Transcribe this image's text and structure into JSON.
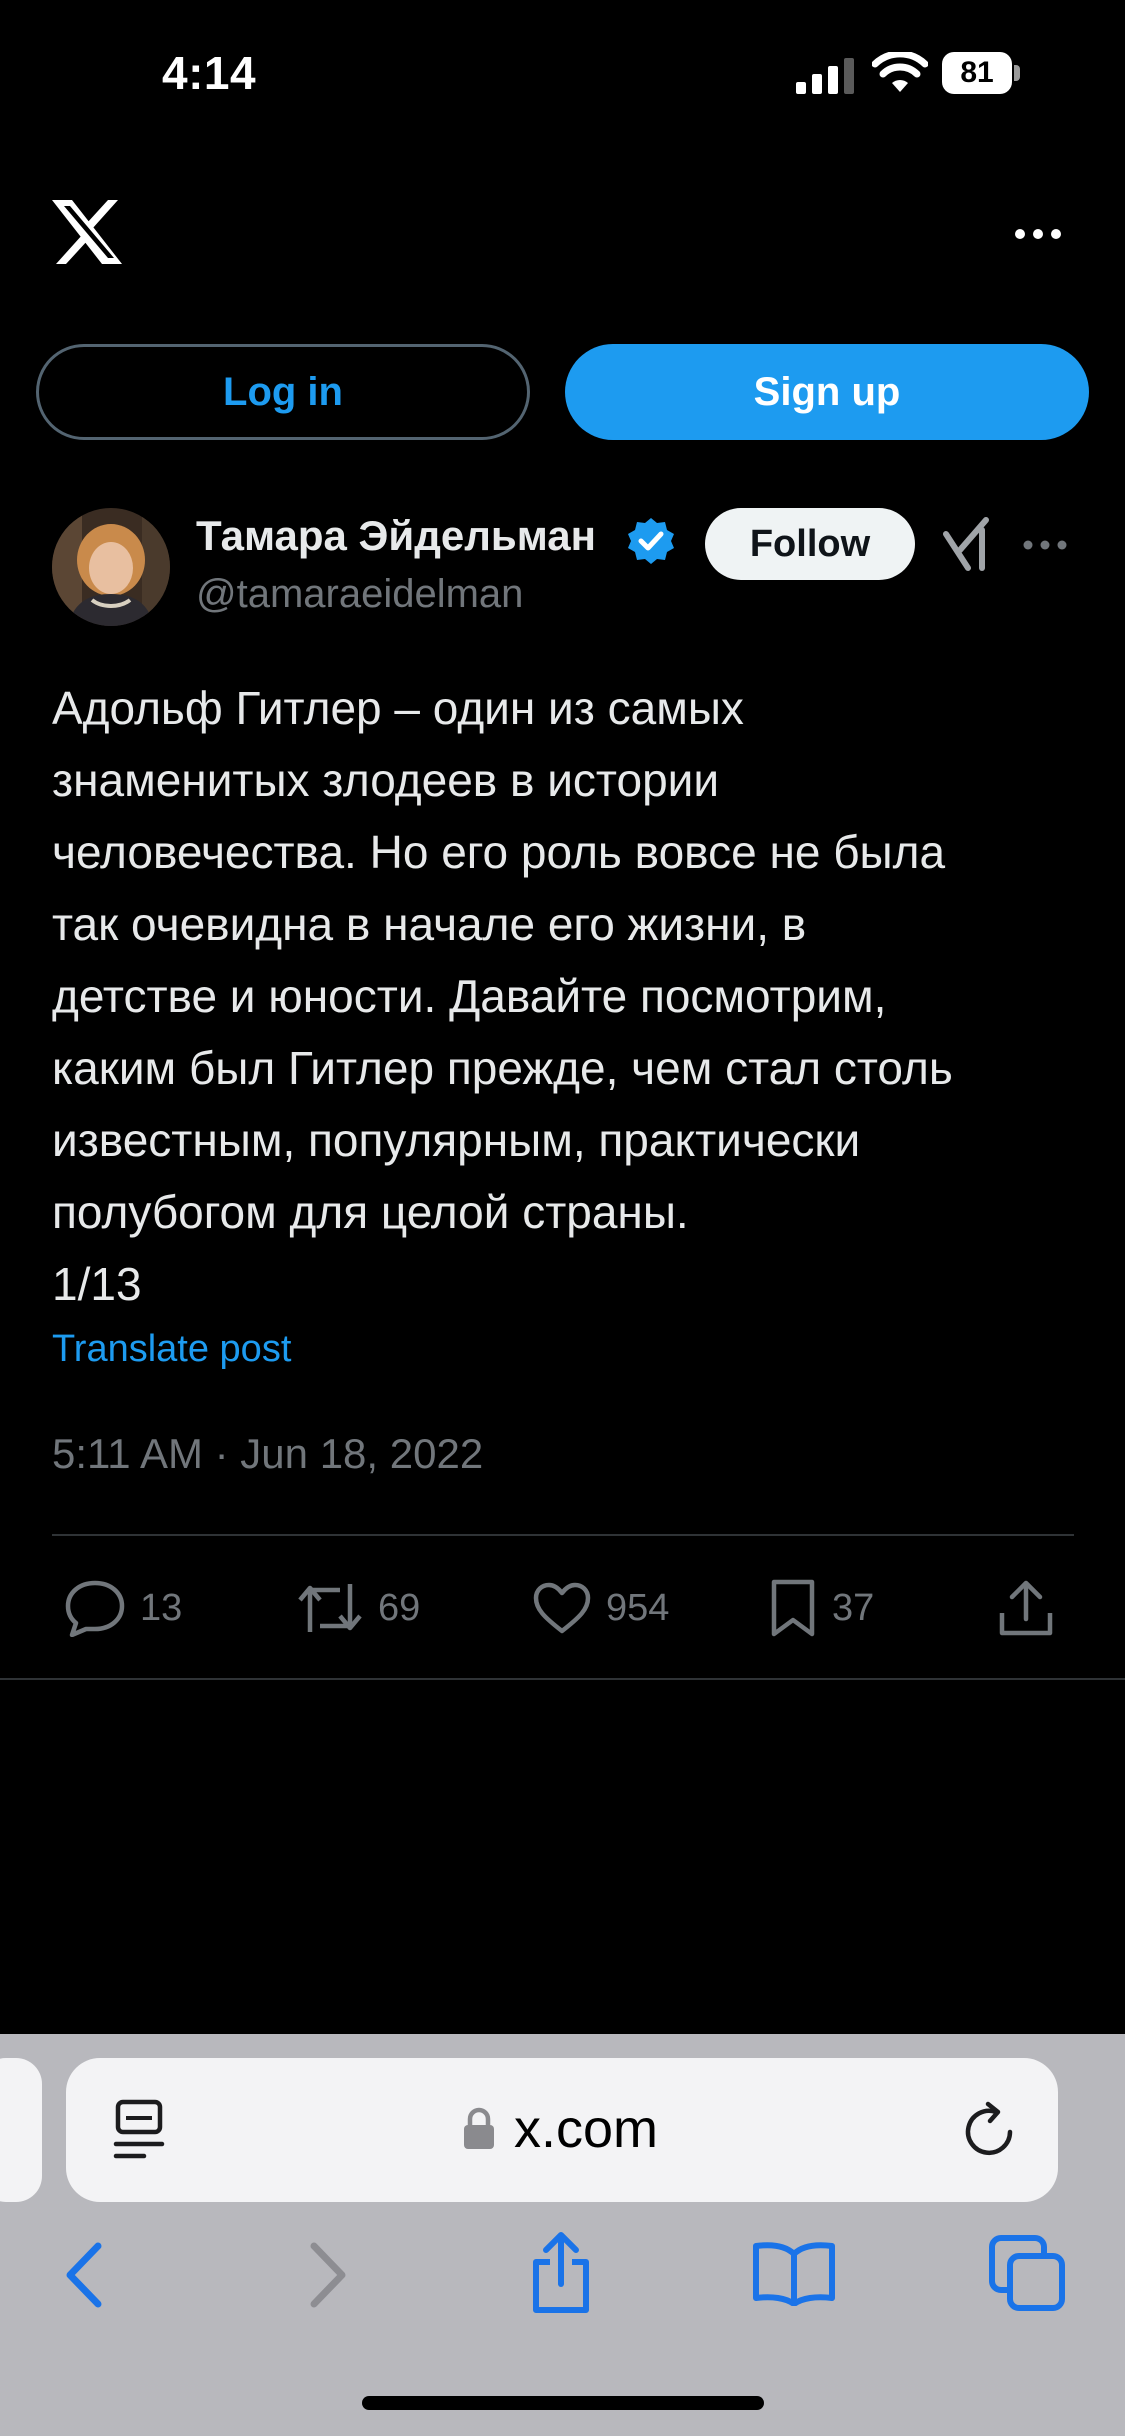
{
  "status_bar": {
    "time": "4:14",
    "battery": "81"
  },
  "header": {
    "logo_icon": "x-logo-icon",
    "menu_icon": "more-horizontal-icon"
  },
  "auth": {
    "login_label": "Log in",
    "signup_label": "Sign up"
  },
  "author": {
    "name": "Тамара Эйдельман",
    "handle": "@tamaraeidelman",
    "verified": true,
    "follow_label": "Follow"
  },
  "tweet": {
    "lines": [
      "Адольф Гитлер – один из самых",
      "знаменитых злодеев в истории",
      "человечества. Но его роль вовсе не была",
      "так очевидна в начале его жизни, в",
      "детстве и юности. Давайте посмотрим,",
      "каким был Гитлер прежде, чем стал столь",
      "известным, популярным, практически",
      "полубогом для целой страны.",
      "1/13"
    ],
    "translate_label": "Translate post",
    "timestamp": "5:11 AM · Jun 18, 2022"
  },
  "actions": {
    "replies": "13",
    "reposts": "69",
    "likes": "954",
    "bookmarks": "37"
  },
  "browser": {
    "url": "x.com"
  },
  "colors": {
    "accent": "#1d9bf0",
    "background": "#000000",
    "muted": "#71767b",
    "safari_toolbar": "#b8b8bd"
  }
}
